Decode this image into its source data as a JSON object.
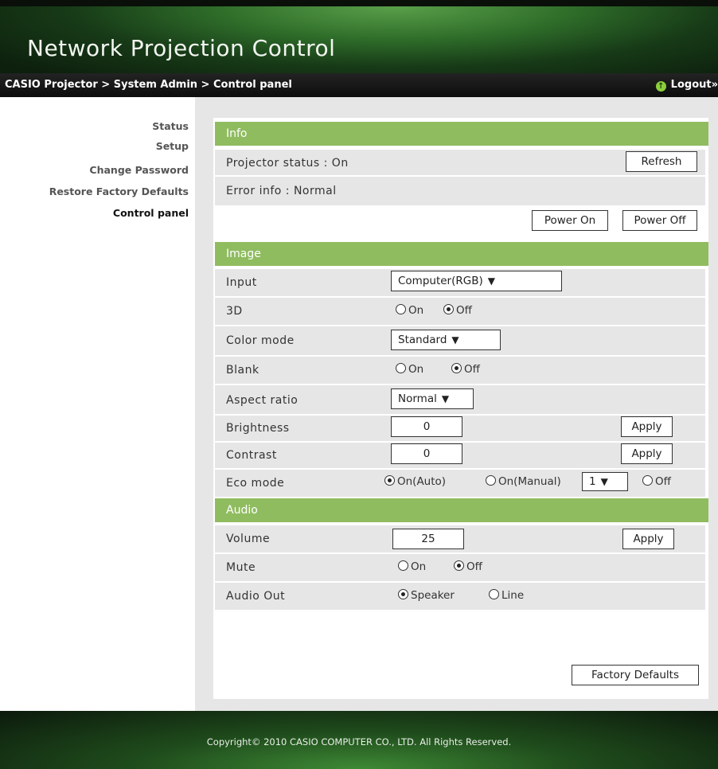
{
  "app": {
    "title": "Network Projection Control"
  },
  "breadcrumb": "CASIO Projector > System Admin > Control panel",
  "logout": {
    "label": "Logout",
    "suffix": "»"
  },
  "sidebar": {
    "items": [
      {
        "label": "Status"
      },
      {
        "label": "Setup"
      },
      {
        "label": "Change Password"
      },
      {
        "label": "Restore Factory Defaults"
      },
      {
        "label": "Control panel",
        "active": true
      }
    ]
  },
  "info": {
    "header": "Info",
    "projector_status": "Projector status : On",
    "error_info": "Error info : Normal",
    "refresh_label": "Refresh",
    "power_on_label": "Power On",
    "power_off_label": "Power Off"
  },
  "image": {
    "header": "Image",
    "input": {
      "label": "Input",
      "value": "Computer(RGB)"
    },
    "three_d": {
      "label": "3D",
      "on": "On",
      "off": "Off",
      "selected": "Off"
    },
    "color_mode": {
      "label": "Color mode",
      "value": "Standard"
    },
    "blank": {
      "label": "Blank",
      "on": "On",
      "off": "Off",
      "selected": "Off"
    },
    "aspect_ratio": {
      "label": "Aspect ratio",
      "value": "Normal"
    },
    "brightness": {
      "label": "Brightness",
      "value": "0",
      "apply_label": "Apply"
    },
    "contrast": {
      "label": "Contrast",
      "value": "0",
      "apply_label": "Apply"
    },
    "eco_mode": {
      "label": "Eco mode",
      "auto": "On(Auto)",
      "manual": "On(Manual)",
      "manual_level": "1",
      "off": "Off",
      "selected": "On(Auto)"
    }
  },
  "audio": {
    "header": "Audio",
    "volume": {
      "label": "Volume",
      "value": "25",
      "apply_label": "Apply"
    },
    "mute": {
      "label": "Mute",
      "on": "On",
      "off": "Off",
      "selected": "Off"
    },
    "audio_out": {
      "label": "Audio Out",
      "speaker": "Speaker",
      "line": "Line",
      "selected": "Speaker"
    }
  },
  "factory_defaults_label": "Factory Defaults",
  "footer": {
    "copyright": "Copyright© 2010 CASIO COMPUTER CO., LTD. All Rights Reserved."
  },
  "colors": {
    "section_header": "#8fbc5f",
    "row_bg": "#e6e6e6",
    "banner_green": "#2f6e2a"
  }
}
